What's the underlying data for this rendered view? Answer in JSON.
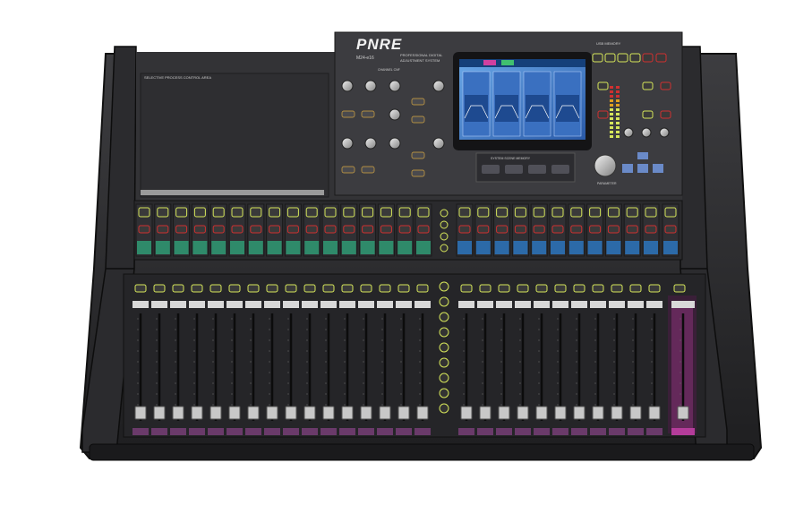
{
  "brand": {
    "name": "PNRE",
    "model": "M24-e16",
    "tagline_1": "PROFESSIONAL DIGITAL",
    "tagline_2": "ADJUSTMENT SYSTEM"
  },
  "panel": {
    "select_area_label": "SELECTIVE PROCESS CONTROL AREA",
    "usb_label": "USB MEMORY",
    "scene_label": "SYSTEM SCENE MEMORY",
    "parameter_label": "PARAMETER",
    "channel_config_label": "CHANNEL CNF"
  },
  "colors": {
    "body": "#2a2a2c",
    "panel": "#3a3a3c",
    "input_strip": "#2f8a6a",
    "bus_strip": "#2c6aa8",
    "master_strip": "#b43c9a",
    "fader_cap": "#c8c8c8",
    "led_green": "#d6e65a",
    "led_red": "#d03030"
  },
  "input_channels": {
    "count": 16
  },
  "bus_channels": {
    "count": 11
  },
  "fader_channels": {
    "input_count": 16,
    "bus_count": 11
  }
}
